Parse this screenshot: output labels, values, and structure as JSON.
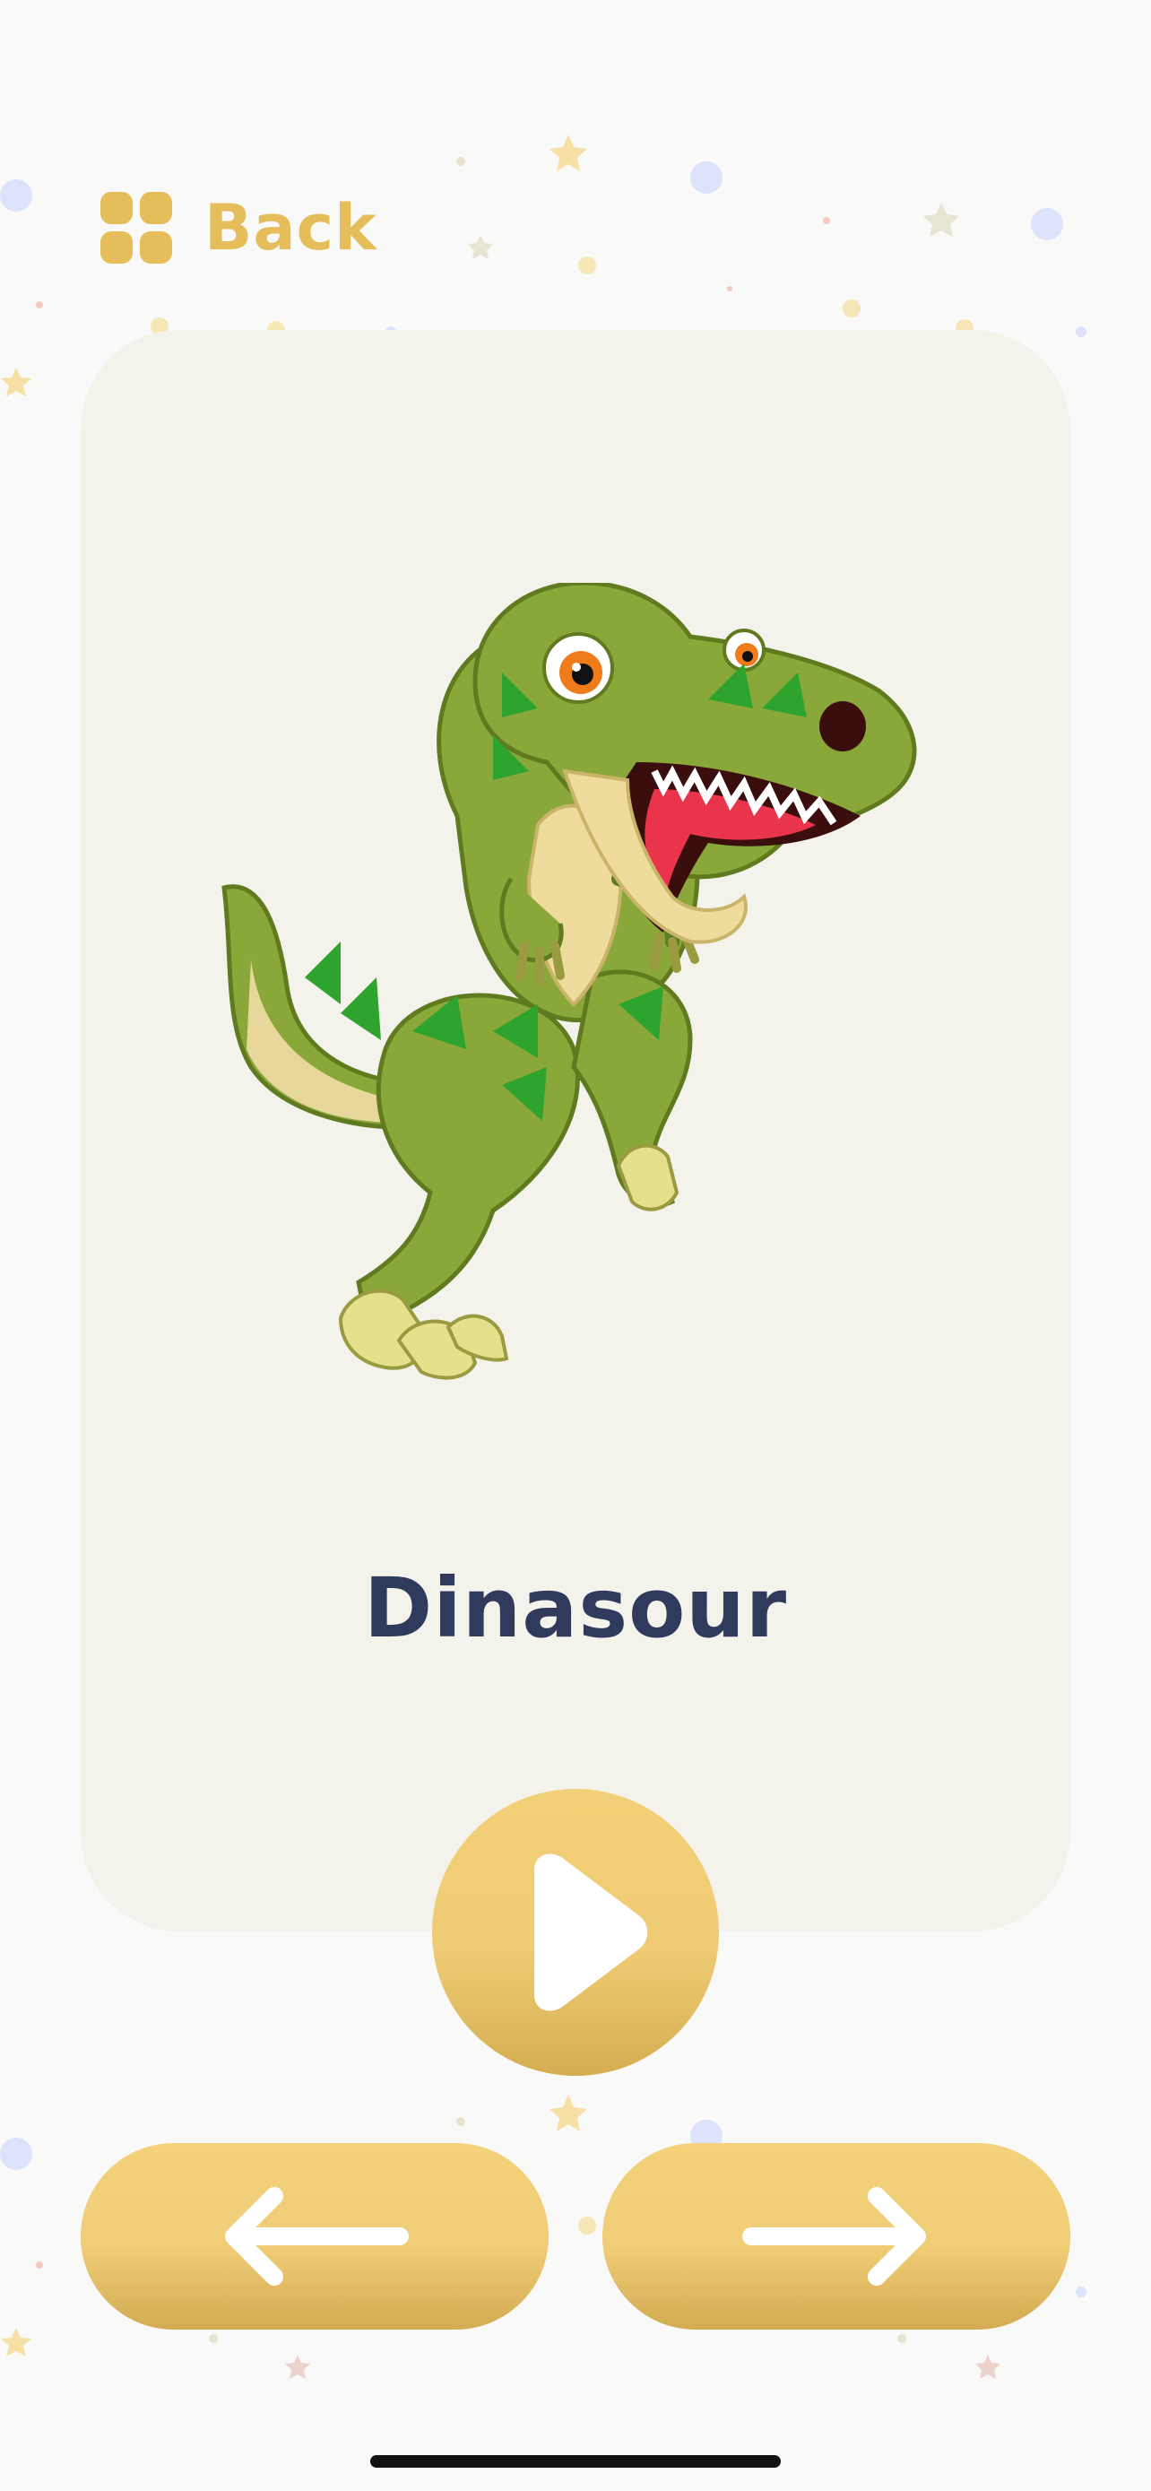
{
  "header": {
    "menu_icon": "grid-icon",
    "back_label": "Back"
  },
  "card": {
    "image_icon": "dinosaur-illustration",
    "word": "Dinasour"
  },
  "controls": {
    "play_icon": "play-icon",
    "prev_icon": "arrow-left-icon",
    "next_icon": "arrow-right-icon"
  },
  "colors": {
    "accent": "#E5BD5A",
    "button": "#F0CD76",
    "card_bg": "#F3F3EC",
    "text": "#2F3A5C"
  }
}
